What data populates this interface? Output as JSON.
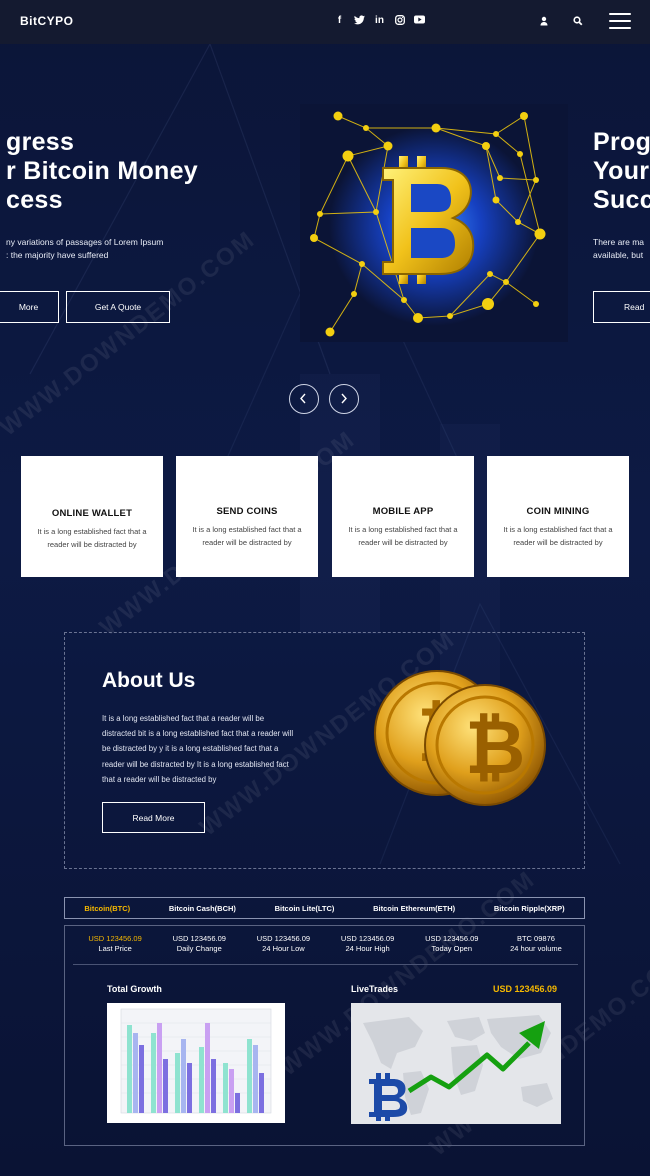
{
  "header": {
    "logo": "BitCYPO",
    "social_icons": [
      "facebook-icon",
      "twitter-icon",
      "linkedin-icon",
      "instagram-icon",
      "youtube-icon"
    ],
    "user_icon": "user-icon",
    "search_icon": "search-icon",
    "menu_icon": "hamburger-menu-icon"
  },
  "hero": {
    "left_slide": {
      "title_line1": "gress",
      "title_line2": "r Bitcoin Money",
      "title_line3": "cess",
      "text_line1": "ny variations of passages of Lorem Ipsum",
      "text_line2": ": the majority have suffered",
      "button1": "More",
      "button2": "Get A Quote"
    },
    "right_slide": {
      "title_line1": "Prog",
      "title_line2": "Your",
      "title_line3": "Succ",
      "text_line1": "There are ma",
      "text_line2": "available, but",
      "button1": "Read"
    },
    "prev_icon": "chevron-left-icon",
    "next_icon": "chevron-right-icon"
  },
  "services": [
    {
      "title": "ONLINE WALLET",
      "text1": "It is a long established fact that a",
      "text2": "reader will be distracted by"
    },
    {
      "title": "SEND COINS",
      "text1": "It is a long established fact that a",
      "text2": "reader will be distracted by"
    },
    {
      "title": "MOBILE APP",
      "text1": "It is a long established fact that a",
      "text2": "reader will be distracted by"
    },
    {
      "title": "COIN MINING",
      "text1": "It is a long established fact that a",
      "text2": "reader will be distracted by"
    }
  ],
  "about": {
    "title": "About Us",
    "line1": "It is a long established fact that a reader will be",
    "line2": "distracted bit is a long established fact that a reader will",
    "line3": "be distracted by y it is a long established fact that a",
    "line4": "reader will be distracted by It is a long established fact",
    "line5": "that a reader will be distracted by",
    "button": "Read More"
  },
  "tabs": [
    "Bitcoin(BTC)",
    "Bitcoin Cash(BCH)",
    "Bitcoin Lite(LTC)",
    "Bitcoin Ethereum(ETH)",
    "Bitcoin Ripple(XRP)"
  ],
  "stats": [
    {
      "value": "USD 123456.09",
      "label": "Last Price"
    },
    {
      "value": "USD 123456.09",
      "label": "Daily Change"
    },
    {
      "value": "USD 123456.09",
      "label": "24 Hour Low"
    },
    {
      "value": "USD 123456.09",
      "label": "24 Hour High"
    },
    {
      "value": "USD 123456.09",
      "label": "Today Open"
    },
    {
      "value": "BTC 09876",
      "label": "24 hour volume"
    }
  ],
  "growth": {
    "title": "Total Growth"
  },
  "live": {
    "title": "LiveTrades",
    "price": "USD 123456.09"
  },
  "watermark": "WWW.DOWNDEMO.COM",
  "colors": {
    "accent": "#f5b800",
    "background": "#0b1436",
    "active_tab": "#f5b800"
  }
}
